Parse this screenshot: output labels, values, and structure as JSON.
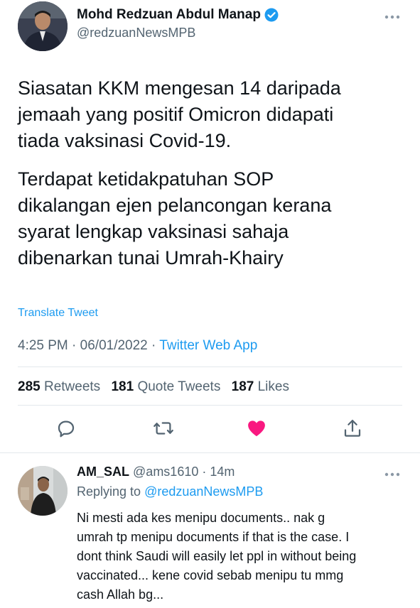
{
  "tweet": {
    "author_name": "Mohd Redzuan Abdul Manap",
    "verified_icon": "verified-badge-icon",
    "handle": "@redzuanNewsMPB",
    "paragraph1": [
      "Siasatan KKM mengesan 14 daripada",
      "jemaah yang positif Omicron didapati",
      "tiada vaksinasi Covid-19."
    ],
    "paragraph2": [
      "Terdapat ketidakpatuhan SOP",
      "dikalangan ejen pelancongan kerana",
      "syarat lengkap vaksinasi sahaja",
      "dibenarkan tunai Umrah-Khairy"
    ],
    "translate_label": "Translate Tweet",
    "time": "4:25 PM",
    "date": "06/01/2022",
    "source": "Twitter Web App",
    "stats": {
      "retweets_count": "285",
      "retweets_label": "Retweets",
      "quotes_count": "181",
      "quotes_label": "Quote Tweets",
      "likes_count": "187",
      "likes_label": "Likes"
    },
    "actions": [
      "reply-icon",
      "retweet-icon",
      "like-icon",
      "share-icon"
    ],
    "colors": {
      "accent": "#1d9bf0",
      "like": "#f91880",
      "muted": "#536471"
    }
  },
  "reply": {
    "name": "AM_SAL",
    "handle": "@ams1610",
    "time": "14m",
    "replying_prefix": "Replying to",
    "replying_handle": "@redzuanNewsMPB",
    "body": [
      "Ni mesti ada kes menipu documents.. nak g",
      "umrah tp menipu documents if that is the case. I",
      "dont think Saudi will easily let ppl in without being",
      "vaccinated... kene covid sebab menipu tu mmg",
      "cash Allah bg..."
    ]
  }
}
